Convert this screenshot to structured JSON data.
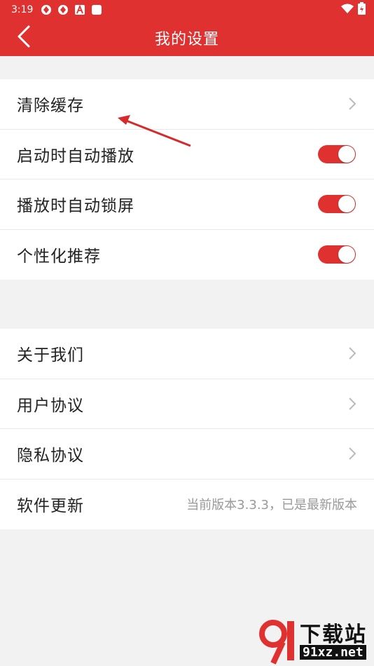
{
  "statusbar": {
    "time": "3:19"
  },
  "header": {
    "title": "我的设置"
  },
  "group1": [
    {
      "label": "清除缓存",
      "control": "chevron"
    },
    {
      "label": "启动时自动播放",
      "control": "toggle",
      "on": true
    },
    {
      "label": "播放时自动锁屏",
      "control": "toggle",
      "on": true
    },
    {
      "label": "个性化推荐",
      "control": "toggle",
      "on": true
    }
  ],
  "group2": [
    {
      "label": "关于我们",
      "control": "chevron"
    },
    {
      "label": "用户协议",
      "control": "chevron"
    },
    {
      "label": "隐私协议",
      "control": "chevron"
    },
    {
      "label": "软件更新",
      "control": "text",
      "value": "当前版本3.3.3，已是最新版本"
    }
  ],
  "watermark": {
    "logo": "91",
    "text": "下载站",
    "url": "91xz.net"
  },
  "colors": {
    "accent": "#e03131",
    "background": "#f2f2f2",
    "toggle_on": "#e03131"
  }
}
